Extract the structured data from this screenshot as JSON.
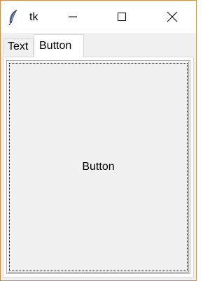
{
  "window": {
    "title": "tk",
    "icon": "feather-icon",
    "controls": [
      "minimize-icon",
      "maximize-icon",
      "close-icon"
    ]
  },
  "notebook": {
    "tabs": [
      {
        "label": "Text",
        "selected": false
      },
      {
        "label": "Button",
        "selected": true
      }
    ]
  },
  "panel": {
    "button_label": "Button"
  },
  "colors": {
    "window_border": "#c88f55",
    "background": "#f0f0f0",
    "titlebar": "#ffffff"
  }
}
